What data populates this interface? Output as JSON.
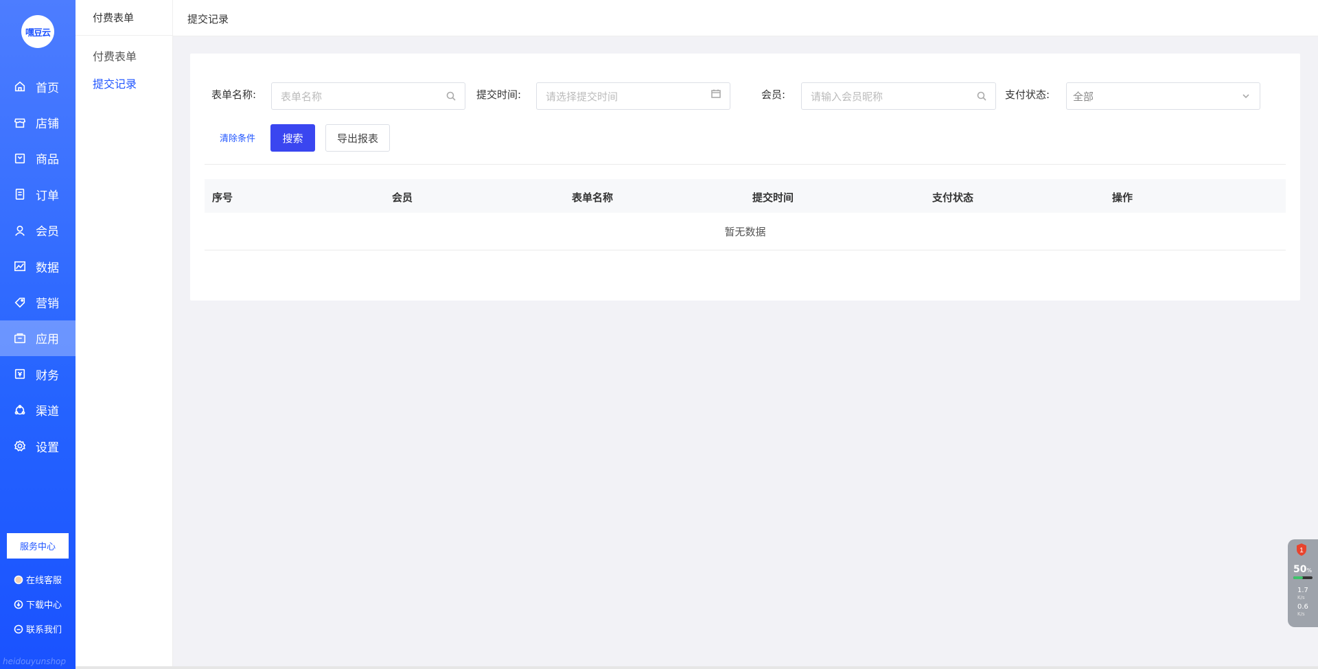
{
  "logo": {
    "text": "嘿豆云"
  },
  "nav": {
    "items": [
      {
        "label": "首页",
        "icon": "home-icon"
      },
      {
        "label": "店铺",
        "icon": "store-icon"
      },
      {
        "label": "商品",
        "icon": "product-icon"
      },
      {
        "label": "订单",
        "icon": "order-icon"
      },
      {
        "label": "会员",
        "icon": "member-icon"
      },
      {
        "label": "数据",
        "icon": "chart-icon"
      },
      {
        "label": "营销",
        "icon": "tag-icon"
      },
      {
        "label": "应用",
        "icon": "app-icon",
        "active": true
      },
      {
        "label": "财务",
        "icon": "finance-icon"
      },
      {
        "label": "渠道",
        "icon": "channel-icon"
      },
      {
        "label": "设置",
        "icon": "gear-icon"
      }
    ]
  },
  "sidebar_bottom": {
    "service_center": "服务中心",
    "online_service": "在线客服",
    "download_center": "下载中心",
    "contact_us": "联系我们",
    "watermark": "heidouyunshop"
  },
  "subnav": {
    "title": "付费表单",
    "items": [
      {
        "label": "付费表单"
      },
      {
        "label": "提交记录",
        "active": true
      }
    ]
  },
  "topbar": {
    "title": "提交记录"
  },
  "filters": {
    "form_name_label": "表单名称:",
    "form_name_placeholder": "表单名称",
    "submit_time_label": "提交时间:",
    "submit_time_placeholder": "请选择提交时间",
    "member_label": "会员:",
    "member_placeholder": "请输入会员昵称",
    "pay_status_label": "支付状态:",
    "pay_status_value": "全部",
    "clear_label": "清除条件",
    "search_label": "搜索",
    "export_label": "导出报表"
  },
  "table": {
    "columns": [
      "序号",
      "会员",
      "表单名称",
      "提交时间",
      "支付状态",
      "操作"
    ],
    "empty_text": "暂无数据"
  },
  "monitor": {
    "badge": "1",
    "cpu_percent": "50",
    "percent_unit": "%",
    "cpu_fraction": 0.5,
    "up_speed": "1.7",
    "down_speed": "0.6",
    "speed_unit": "K/s"
  },
  "colors": {
    "accent": "#2156ff",
    "search_button": "#3a46f0",
    "sidebar_top": "#4d7dff",
    "sidebar_bottom": "#1a52ff"
  }
}
